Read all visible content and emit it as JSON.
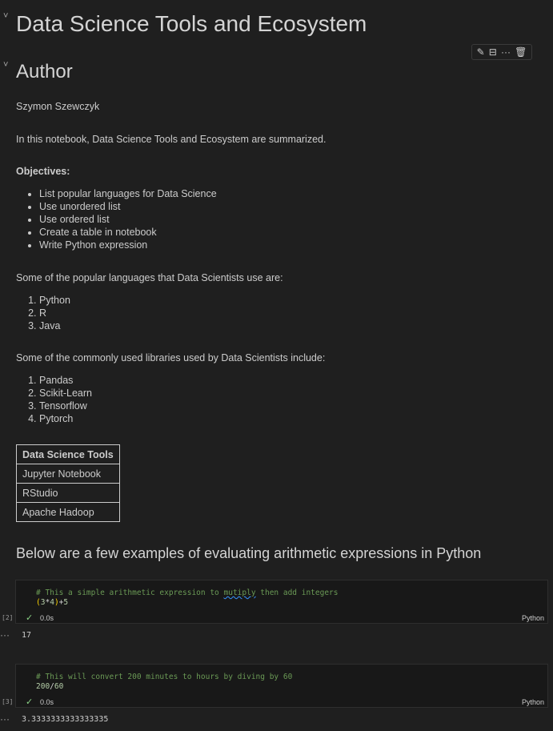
{
  "title": "Data Science Tools and Ecosystem",
  "author_heading": "Author",
  "author_name": "Szymon Szewczyk",
  "intro": "In this notebook, Data Science Tools and Ecosystem are summarized.",
  "objectives_label": "Objectives:",
  "objectives": [
    "List popular languages for Data Science",
    "Use unordered list",
    "Use ordered list",
    "Create a table in notebook",
    "Write Python expression"
  ],
  "languages_intro": "Some of the popular languages that Data Scientists use are:",
  "languages": [
    "Python",
    "R",
    "Java"
  ],
  "libraries_intro": "Some of the commonly used libraries used by Data Scientists include:",
  "libraries": [
    "Pandas",
    "Scikit-Learn",
    "Tensorflow",
    "Pytorch"
  ],
  "table": {
    "header": "Data Science Tools",
    "rows": [
      "Jupyter Notebook",
      "RStudio",
      "Apache Hadoop"
    ]
  },
  "examples_heading": "Below are a few examples of evaluating arithmetic expressions in Python",
  "toolbar": {
    "edit_icon": "pencil-icon",
    "split_icon": "split-cell-icon",
    "more_icon": "ellipsis-icon",
    "delete_icon": "trash-icon"
  },
  "cells": [
    {
      "exec_count": "[2]",
      "comment_pre": "# This a simple arithmetic expression to ",
      "comment_word": "mutiply",
      "comment_post": " then add integers",
      "code": "(3*4)+5",
      "time": "0.0s",
      "language": "Python",
      "output_marker": "···",
      "output": "17"
    },
    {
      "exec_count": "[3]",
      "comment": "# This will convert 200 minutes to hours by diving by 60",
      "code": "200/60",
      "time": "0.0s",
      "language": "Python",
      "output_marker": "···",
      "output": "3.3333333333333335"
    }
  ]
}
